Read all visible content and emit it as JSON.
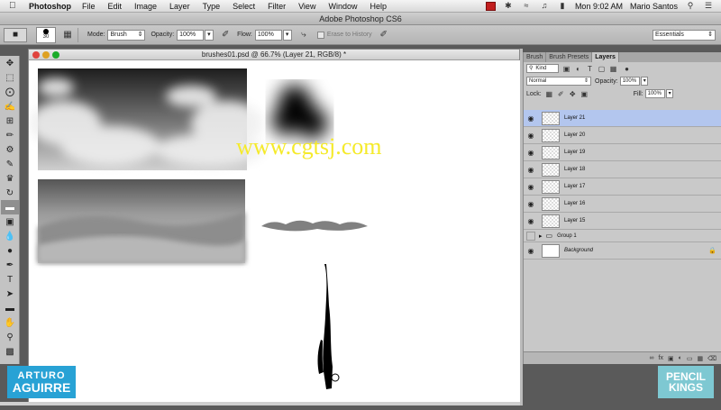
{
  "menubar": {
    "app_name": "Photoshop",
    "items": [
      "File",
      "Edit",
      "Image",
      "Layer",
      "Type",
      "Select",
      "Filter",
      "View",
      "Window",
      "Help"
    ],
    "clock": "Mon 9:02 AM",
    "user": "Mario Santos"
  },
  "window": {
    "title": "Adobe Photoshop CS6"
  },
  "options": {
    "brush_size": "30",
    "mode_label": "Mode:",
    "mode_value": "Brush",
    "opacity_label": "Opacity:",
    "opacity_value": "100%",
    "flow_label": "Flow:",
    "flow_value": "100%",
    "erase_history": "Erase to History",
    "workspace": "Essentials"
  },
  "document": {
    "title": "brushes01.psd @ 66.7% (Layer 21, RGB/8) *",
    "watermark": "www.cgtsj.com"
  },
  "panel": {
    "tabs": [
      "Brush",
      "Brush Presets",
      "Layers"
    ],
    "active_tab": "Layers",
    "filter_kind": "Kind",
    "blend_mode": "Normal",
    "opacity_label": "Opacity:",
    "opacity_value": "100%",
    "lock_label": "Lock:",
    "fill_label": "Fill:",
    "fill_value": "100%",
    "layers": [
      {
        "name": "Layer 21",
        "selected": true
      },
      {
        "name": "Layer 20"
      },
      {
        "name": "Layer 19"
      },
      {
        "name": "Layer 18"
      },
      {
        "name": "Layer 17"
      },
      {
        "name": "Layer 16"
      },
      {
        "name": "Layer 15"
      },
      {
        "name": "Group 1"
      },
      {
        "name": "Background"
      }
    ]
  },
  "logos": {
    "left_line1": "ARTURO",
    "left_line2": "AGUIRRE",
    "right_line1": "PENCIL",
    "right_line2": "KINGS"
  },
  "colors": {
    "selected_layer": "#b3c6ee",
    "watermark": "#f5ea2a",
    "left_logo": "#28a2d5",
    "right_logo": "#7ec8d2"
  }
}
